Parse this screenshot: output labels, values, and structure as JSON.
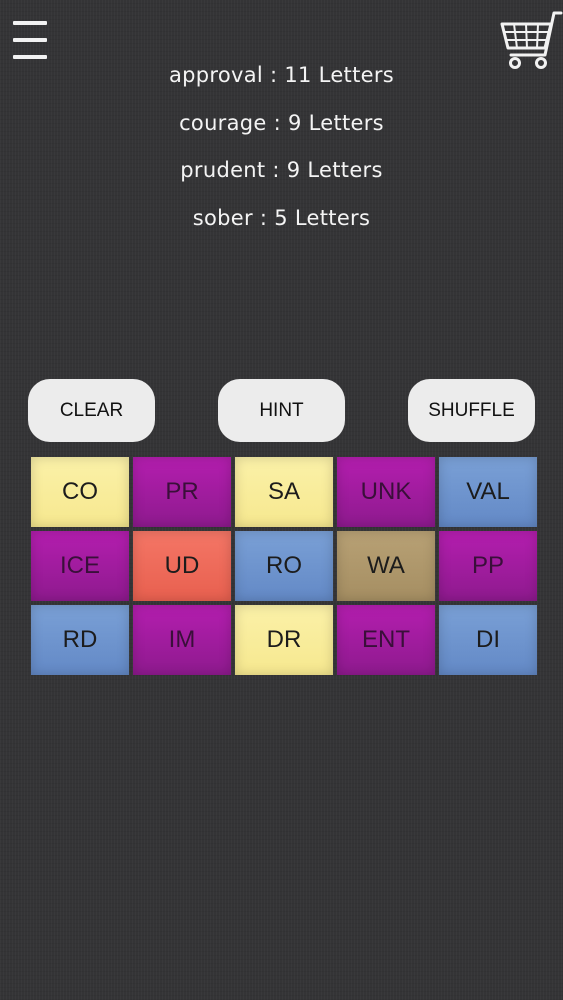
{
  "header": {
    "menu_icon": "hamburger-menu-icon",
    "cart_icon": "shopping-cart-icon"
  },
  "clues": [
    {
      "text": "approval : 11 Letters"
    },
    {
      "text": "courage : 9 Letters"
    },
    {
      "text": "prudent : 9 Letters"
    },
    {
      "text": "sober : 5 Letters"
    }
  ],
  "buttons": {
    "clear": "CLEAR",
    "hint": "HINT",
    "shuffle": "SHUFFLE"
  },
  "tiles": [
    {
      "text": "CO",
      "color": "#f8ec9a"
    },
    {
      "text": "PR",
      "color": "#a21c9f"
    },
    {
      "text": "SA",
      "color": "#f8ec9a"
    },
    {
      "text": "UNK",
      "color": "#a21c9f"
    },
    {
      "text": "VAL",
      "color": "#6f96d0"
    },
    {
      "text": "ICE",
      "color": "#a21c9f"
    },
    {
      "text": "UD",
      "color": "#ee6b5a"
    },
    {
      "text": "RO",
      "color": "#6f96d0"
    },
    {
      "text": "WA",
      "color": "#ae976b"
    },
    {
      "text": "PP",
      "color": "#a21c9f"
    },
    {
      "text": "RD",
      "color": "#6f96d0"
    },
    {
      "text": "IM",
      "color": "#a21c9f"
    },
    {
      "text": "DR",
      "color": "#f8ec9a"
    },
    {
      "text": "ENT",
      "color": "#a21c9f"
    },
    {
      "text": "DI",
      "color": "#6f96d0"
    }
  ]
}
